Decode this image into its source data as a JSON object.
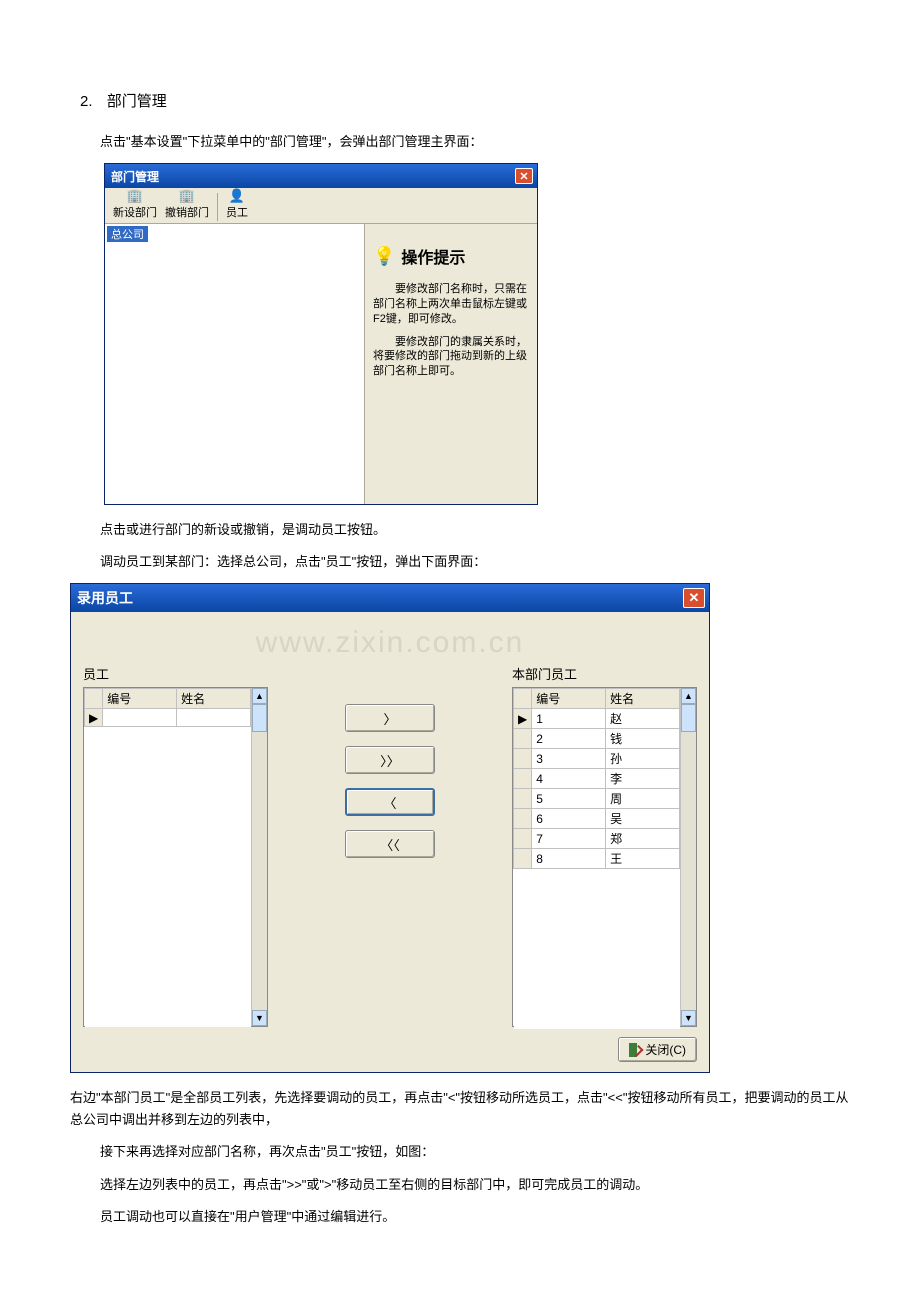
{
  "section": {
    "number": "2.",
    "title": "部门管理"
  },
  "para1": "点击\"基本设置\"下拉菜单中的\"部门管理\"，会弹出部门管理主界面：",
  "win1": {
    "title": "部门管理",
    "toolbar": {
      "newDept": "新设部门",
      "delDept": "撤销部门",
      "employee": "员工"
    },
    "rootNode": "总公司",
    "tip": {
      "title": "操作提示",
      "p1": "要修改部门名称时，只需在部门名称上两次单击鼠标左键或F2键，即可修改。",
      "p2": "要修改部门的隶属关系时，将要修改的部门拖动到新的上级部门名称上即可。"
    }
  },
  "para2": "点击或进行部门的新设或撤销，是调动员工按钮。",
  "para3": "调动员工到某部门：选择总公司，点击\"员工\"按钮，弹出下面界面：",
  "win2": {
    "title": "录用员工",
    "watermark": "www.zixin.com.cn",
    "leftTitle": "员工",
    "rightTitle": "本部门员工",
    "cols": {
      "id": "编号",
      "name": "姓名"
    },
    "rightRows": [
      {
        "id": "1",
        "name": "赵"
      },
      {
        "id": "2",
        "name": "钱"
      },
      {
        "id": "3",
        "name": "孙"
      },
      {
        "id": "4",
        "name": "李"
      },
      {
        "id": "5",
        "name": "周"
      },
      {
        "id": "6",
        "name": "吴"
      },
      {
        "id": "7",
        "name": "郑"
      },
      {
        "id": "8",
        "name": "王"
      }
    ],
    "btnRight": "〉",
    "btnRightAll": "〉〉",
    "btnLeft": "〈",
    "btnLeftAll": "〈〈",
    "closeLabel": "关闭(C)"
  },
  "para4": "右边\"本部门员工\"是全部员工列表，先选择要调动的员工，再点击\"<\"按钮移动所选员工，点击\"<<\"按钮移动所有员工，把要调动的员工从总公司中调出并移到左边的列表中，",
  "para5": "接下来再选择对应部门名称，再次点击\"员工\"按钮，如图：",
  "para6": "选择左边列表中的员工，再点击\">>\"或\">\"移动员工至右侧的目标部门中，即可完成员工的调动。",
  "para7": "员工调动也可以直接在\"用户管理\"中通过编辑进行。"
}
